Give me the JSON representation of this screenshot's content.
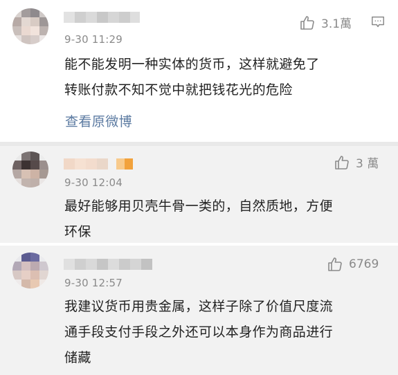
{
  "comments": [
    {
      "time": "9-30 11:29",
      "likes": "3.1萬",
      "lines": [
        "能不能发明一种实体的货币，这样就避免了",
        "转账付款不知不觉中就把钱花光的危险"
      ],
      "view_original": "查看原微博"
    },
    {
      "time": "9-30 12:04",
      "likes": "3 萬",
      "lines": [
        "最好能够用贝壳牛骨一类的，自然质地，方便",
        "环保"
      ]
    },
    {
      "time": "9-30 12:57",
      "likes": "6769",
      "lines": [
        "我建议货币用贵金属，这样子除了价值尺度流",
        "通手段支付手段之外还可以本身作为商品进行",
        "储藏"
      ]
    }
  ],
  "icons": {
    "like": "thumbs-up-icon",
    "comment": "comment-icon"
  },
  "colors": {
    "link": "#5b7aa1",
    "meta": "#8a8a8a",
    "card_bg": "#f2f2f2"
  }
}
